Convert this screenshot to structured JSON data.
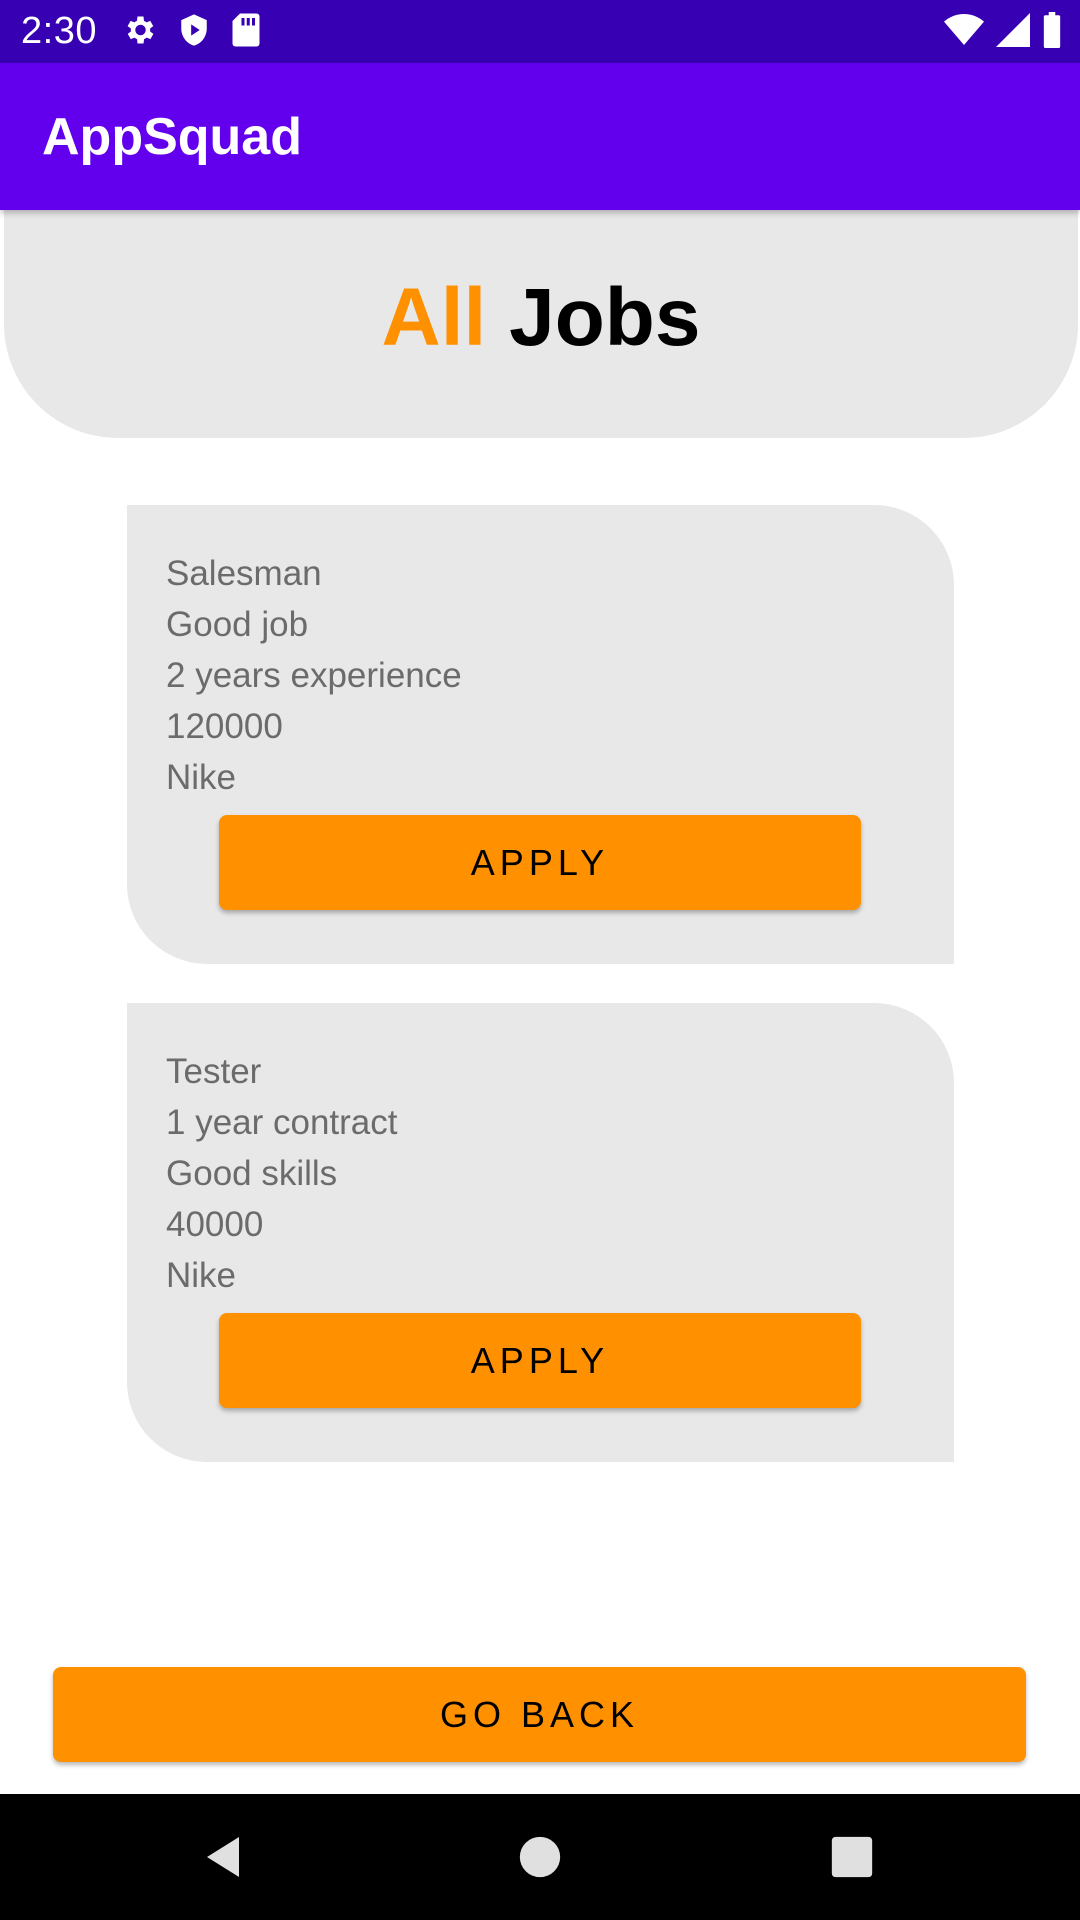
{
  "status_bar": {
    "time": "2:30",
    "left_icons": [
      "gear-icon",
      "shield-icon",
      "sd-card-icon"
    ],
    "right_icons": [
      "wifi-icon",
      "signal-icon",
      "battery-icon"
    ]
  },
  "app_bar": {
    "title": "AppSquad"
  },
  "header": {
    "accent_word": "All",
    "rest": " Jobs"
  },
  "jobs": [
    {
      "lines": [
        "Salesman",
        "Good job",
        "2 years experience",
        "120000",
        "Nike"
      ],
      "apply_label": "APPLY"
    },
    {
      "lines": [
        "Tester",
        "1 year contract",
        "Good skills",
        "40000",
        "Nike"
      ],
      "apply_label": "APPLY"
    }
  ],
  "go_back_label": "GO BACK",
  "nav": [
    "back-icon",
    "home-icon",
    "recents-icon"
  ],
  "colors": {
    "status_bar": "#3700b3",
    "app_bar": "#6200ee",
    "accent": "#ff9100",
    "panel": "#e8e8e8",
    "body_text": "#6b6b6b"
  }
}
